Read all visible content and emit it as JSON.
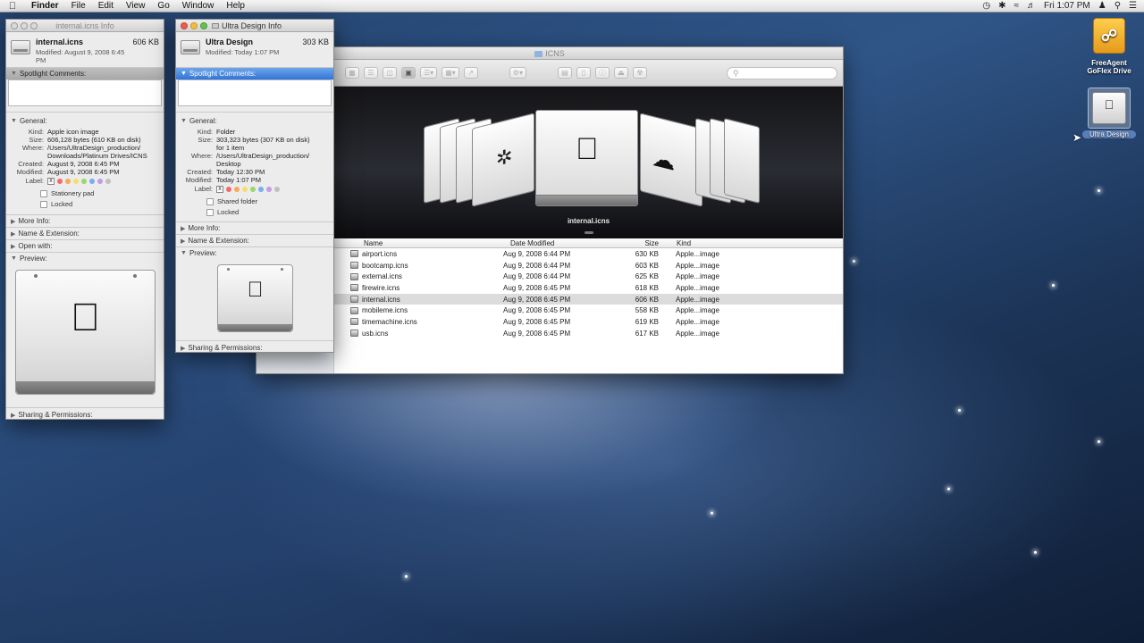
{
  "menubar": {
    "app_name": "Finder",
    "items": [
      "File",
      "Edit",
      "View",
      "Go",
      "Window",
      "Help"
    ],
    "clock": "Fri 1:07 PM",
    "status_icons": [
      "time-machine-icon",
      "bluetooth-icon",
      "wifi-icon",
      "volume-icon",
      "user-icon",
      "spotlight-icon",
      "notification-center-icon"
    ]
  },
  "info_internal": {
    "title": "internal.icns Info",
    "name": "internal.icns",
    "size": "606 KB",
    "modified_line": "Modified: August 9, 2008 6:45 PM",
    "spotlight": "Spotlight Comments:",
    "general": "General:",
    "fields": [
      {
        "k": "Kind:",
        "v": "Apple icon image"
      },
      {
        "k": "Size:",
        "v": "606,128 bytes (610 KB on disk)"
      },
      {
        "k": "Where:",
        "v": "/Users/UltraDesign_production/"
      },
      {
        "k": "",
        "v": "Downloads/Platinum Drives/ICNS"
      },
      {
        "k": "Created:",
        "v": "August 9, 2008 6:45 PM"
      },
      {
        "k": "Modified:",
        "v": "August 9, 2008 6:45 PM"
      }
    ],
    "label_key": "Label:",
    "stationery": "Stationery pad",
    "locked": "Locked",
    "more_info": "More Info:",
    "name_ext": "Name & Extension:",
    "open_with": "Open with:",
    "preview": "Preview:",
    "sharing": "Sharing & Permissions:"
  },
  "info_ultra": {
    "title": "Ultra Design Info",
    "name": "Ultra Design",
    "size": "303 KB",
    "modified_line": "Modified: Today 1:07 PM",
    "spotlight": "Spotlight Comments:",
    "general": "General:",
    "fields": [
      {
        "k": "Kind:",
        "v": "Folder"
      },
      {
        "k": "Size:",
        "v": "303,323 bytes (307 KB on disk)"
      },
      {
        "k": "",
        "v": "for 1 item"
      },
      {
        "k": "Where:",
        "v": "/Users/UltraDesign_production/"
      },
      {
        "k": "",
        "v": "Desktop"
      },
      {
        "k": "Created:",
        "v": "Today 12:30 PM"
      },
      {
        "k": "Modified:",
        "v": "Today 1:07 PM"
      }
    ],
    "label_key": "Label:",
    "shared": "Shared folder",
    "locked": "Locked",
    "more_info": "More Info:",
    "name_ext": "Name & Extension:",
    "preview": "Preview:",
    "sharing": "Sharing & Permissions:"
  },
  "label_colors": [
    "#f26b6b",
    "#f5a95b",
    "#f4df6a",
    "#9ed46d",
    "#76aef0",
    "#c59be3",
    "#c0c0c0"
  ],
  "finder": {
    "title": "ICNS",
    "search_placeholder": "",
    "coverflow_caption": "internal.icns",
    "columns": {
      "name": "Name",
      "date": "Date Modified",
      "size": "Size",
      "kind": "Kind"
    },
    "files": [
      {
        "name": "airport.icns",
        "date": "Aug 9, 2008 6:44 PM",
        "size": "630 KB",
        "kind": "Apple...image"
      },
      {
        "name": "bootcamp.icns",
        "date": "Aug 9, 2008 6:44 PM",
        "size": "603 KB",
        "kind": "Apple...image"
      },
      {
        "name": "external.icns",
        "date": "Aug 9, 2008 6:44 PM",
        "size": "625 KB",
        "kind": "Apple...image"
      },
      {
        "name": "firewire.icns",
        "date": "Aug 9, 2008 6:45 PM",
        "size": "618 KB",
        "kind": "Apple...image"
      },
      {
        "name": "internal.icns",
        "date": "Aug 9, 2008 6:45 PM",
        "size": "606 KB",
        "kind": "Apple...image"
      },
      {
        "name": "mobileme.icns",
        "date": "Aug 9, 2008 6:45 PM",
        "size": "558 KB",
        "kind": "Apple...image"
      },
      {
        "name": "timemachine.icns",
        "date": "Aug 9, 2008 6:45 PM",
        "size": "619 KB",
        "kind": "Apple...image"
      },
      {
        "name": "usb.icns",
        "date": "Aug 9, 2008 6:45 PM",
        "size": "617 KB",
        "kind": "Apple...image"
      }
    ],
    "selected_index": 4
  },
  "desktop": {
    "icons": [
      {
        "label_1": "FreeAgent",
        "label_2": "GoFlex Drive"
      },
      {
        "label_1": "Ultra Design"
      }
    ]
  }
}
